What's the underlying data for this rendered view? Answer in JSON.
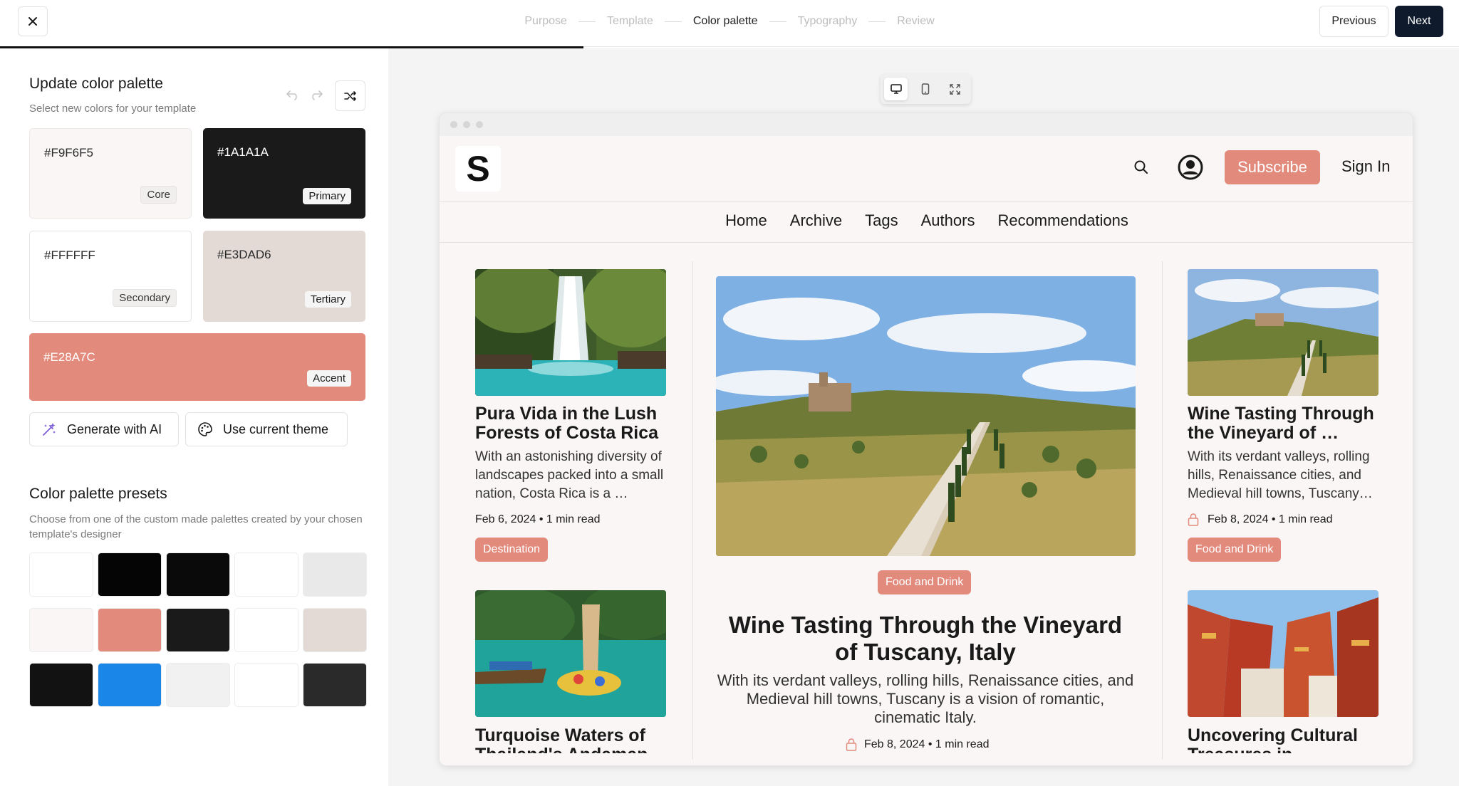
{
  "wizard": {
    "steps": [
      "Purpose",
      "Template",
      "Color palette",
      "Typography",
      "Review"
    ],
    "active_step": "Color palette",
    "previous_label": "Previous",
    "next_label": "Next",
    "progress_fraction": 0.4
  },
  "palette": {
    "title": "Update color palette",
    "subtitle": "Select new colors for your template",
    "swatches": {
      "core": {
        "hex": "#F9F6F5",
        "label": "Core"
      },
      "primary": {
        "hex": "#1A1A1A",
        "label": "Primary"
      },
      "secondary": {
        "hex": "#FFFFFF",
        "label": "Secondary"
      },
      "tertiary": {
        "hex": "#E3DAD6",
        "label": "Tertiary"
      },
      "accent": {
        "hex": "#E28A7C",
        "label": "Accent"
      }
    },
    "generate_label": "Generate with AI",
    "use_current_label": "Use current theme"
  },
  "presets": {
    "title": "Color palette presets",
    "subtitle": "Choose from one of the custom made palettes created by your chosen template's designer",
    "rows": [
      [
        "#FFFFFF",
        "#050505",
        "#0A0A0A",
        "#FFFFFF",
        "#E9E9EA"
      ],
      [
        "#F9F6F5",
        "#E28A7C",
        "#1A1A1A",
        "#FFFFFF",
        "#E3DAD6"
      ],
      [
        "#121212",
        "#1A86E8",
        "#F1F1F1",
        "#FFFFFF",
        "#2A2A2A"
      ]
    ]
  },
  "preview": {
    "site": {
      "logo_letter": "S",
      "subscribe_label": "Subscribe",
      "signin_label": "Sign In",
      "nav": [
        "Home",
        "Archive",
        "Tags",
        "Authors",
        "Recommendations"
      ]
    },
    "left_card": {
      "title": "Pura Vida in the Lush Forests of Costa Rica",
      "excerpt": "With an astonishing diversity of landscapes packed into a small nation, Costa Rica is a …",
      "meta": "Feb 6, 2024 • 1 min read",
      "tag": "Destination"
    },
    "left_card2": {
      "title": "Turquoise Waters of Thailand's Andaman"
    },
    "hero": {
      "tag": "Food and Drink",
      "title": "Wine Tasting Through the Vineyard of Tuscany, Italy",
      "excerpt": "With its verdant valleys, rolling hills, Renaissance cities, and Medieval hill towns, Tuscany is a vision of romantic, cinematic Italy.",
      "meta": "Feb 8, 2024 • 1 min read"
    },
    "right_card": {
      "title": "Wine Tasting Through the Vineyard of …",
      "excerpt": "With its verdant valleys, rolling hills, Renaissance cities, and Medieval hill towns, Tuscany…",
      "meta": "Feb 8, 2024 • 1 min read",
      "tag": "Food and Drink"
    },
    "right_card2": {
      "title": "Uncovering Cultural Treasures in"
    }
  },
  "colors": {
    "accent": "#E28A7C",
    "primary": "#1A1A1A",
    "core": "#F9F6F5",
    "next_button": "#0F1B2D"
  },
  "icons": [
    "close-icon",
    "undo-icon",
    "redo-icon",
    "shuffle-icon",
    "magic-wand-icon",
    "palette-icon",
    "desktop-icon",
    "mobile-icon",
    "fullscreen-icon",
    "search-icon",
    "account-icon",
    "lock-icon"
  ]
}
